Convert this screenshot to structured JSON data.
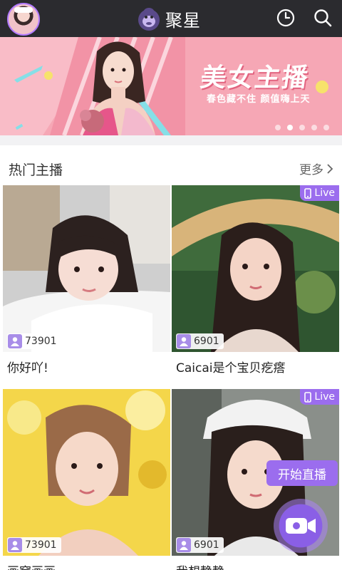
{
  "header": {
    "brand": "聚星",
    "avatar_icon": "user-avatar",
    "history_icon": "clock-icon",
    "search_icon": "search-icon"
  },
  "banner": {
    "title": "美女主播",
    "subtitle": "春色藏不住  颜值嗨上天",
    "slide_count": 5,
    "active_slide": 2
  },
  "section": {
    "title": "热门主播",
    "more_label": "更多"
  },
  "cards": [
    {
      "caption": "你好吖!",
      "viewers": "73901",
      "live": false
    },
    {
      "caption": "Caicai是个宝贝疙瘩",
      "viewers": "6901",
      "live": true,
      "live_label": "Live"
    },
    {
      "caption": "画窝画画",
      "viewers": "73901",
      "live": false
    },
    {
      "caption": "我想静静",
      "viewers": "6901",
      "live": true,
      "live_label": "Live"
    }
  ],
  "floating": {
    "start_live_label": "开始直播",
    "camera_icon": "video-camera-icon"
  },
  "colors": {
    "topbar": "#2b2b2f",
    "accent": "#9b6dee",
    "banner": "#f6a7b5"
  }
}
